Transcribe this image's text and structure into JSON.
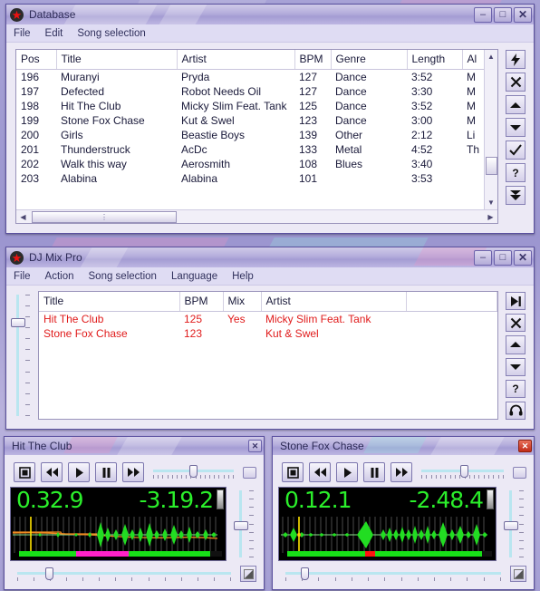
{
  "desktop": {
    "bg_color": "#a29ccf"
  },
  "database_window": {
    "title": "Database",
    "icon": "red-star-icon",
    "titlebar_buttons": [
      {
        "name": "minimize",
        "glyph": "–"
      },
      {
        "name": "maximize",
        "glyph": "□"
      },
      {
        "name": "close",
        "glyph": "✕"
      }
    ],
    "menu": [
      "File",
      "Edit",
      "Song selection"
    ],
    "columns": [
      "Pos",
      "Title",
      "Artist",
      "BPM",
      "Genre",
      "Length",
      "Al"
    ],
    "rows": [
      {
        "pos": "196",
        "title": "Muranyi",
        "artist": "Pryda",
        "bpm": "127",
        "genre": "Dance",
        "length": "3:52",
        "album": "M"
      },
      {
        "pos": "197",
        "title": "Defected",
        "artist": "Robot Needs Oil",
        "bpm": "127",
        "genre": "Dance",
        "length": "3:30",
        "album": "M"
      },
      {
        "pos": "198",
        "title": "Hit The Club",
        "artist": "Micky Slim Feat. Tank",
        "bpm": "125",
        "genre": "Dance",
        "length": "3:52",
        "album": "M"
      },
      {
        "pos": "199",
        "title": "Stone Fox Chase",
        "artist": "Kut & Swel",
        "bpm": "123",
        "genre": "Dance",
        "length": "3:00",
        "album": "M"
      },
      {
        "pos": "200",
        "title": "Girls",
        "artist": "Beastie Boys",
        "bpm": "139",
        "genre": "Other",
        "length": "2:12",
        "album": "Li"
      },
      {
        "pos": "201",
        "title": "Thunderstruck",
        "artist": "AcDc",
        "bpm": "133",
        "genre": "Metal",
        "length": "4:52",
        "album": "Th"
      },
      {
        "pos": "202",
        "title": "Walk this way",
        "artist": "Aerosmith",
        "bpm": "108",
        "genre": "Blues",
        "length": "3:40",
        "album": ""
      },
      {
        "pos": "203",
        "title": "Alabina",
        "artist": "Alabina",
        "bpm": "101",
        "genre": "",
        "length": "3:53",
        "album": ""
      }
    ],
    "toolbar": [
      {
        "name": "auto-bpm-button",
        "icon": "lightning-bolt-icon"
      },
      {
        "name": "remove-button",
        "icon": "cross-icon"
      },
      {
        "name": "move-up-button",
        "icon": "triangle-up-icon"
      },
      {
        "name": "move-down-button",
        "icon": "triangle-down-icon"
      },
      {
        "name": "confirm-button",
        "icon": "check-icon"
      },
      {
        "name": "help-button",
        "icon": "question-mark-icon"
      },
      {
        "name": "add-to-mix-button",
        "icon": "double-chevron-down-icon"
      }
    ]
  },
  "djmix_window": {
    "title": "DJ Mix Pro",
    "icon": "red-star-icon",
    "titlebar_buttons": [
      {
        "name": "minimize",
        "glyph": "–"
      },
      {
        "name": "maximize",
        "glyph": "□"
      },
      {
        "name": "close",
        "glyph": "✕"
      }
    ],
    "menu": [
      "File",
      "Action",
      "Song selection",
      "Language",
      "Help"
    ],
    "columns": [
      "Title",
      "BPM",
      "Mix",
      "Artist",
      ""
    ],
    "rows": [
      {
        "title": "Hit The Club",
        "bpm": "125",
        "mix": "Yes",
        "artist": "Micky Slim Feat. Tank"
      },
      {
        "title": "Stone Fox Chase",
        "bpm": "123",
        "mix": "",
        "artist": "Kut & Swel"
      }
    ],
    "toolbar": [
      {
        "name": "play-next-button",
        "icon": "skip-to-end-icon"
      },
      {
        "name": "remove-button",
        "icon": "cross-icon"
      },
      {
        "name": "move-up-button",
        "icon": "triangle-up-icon"
      },
      {
        "name": "move-down-button",
        "icon": "triangle-down-icon"
      },
      {
        "name": "help-button",
        "icon": "question-mark-icon"
      },
      {
        "name": "monitor-button",
        "icon": "headphones-icon"
      }
    ],
    "volume_slider": {
      "name": "master-volume-slider",
      "value_pct": 22
    }
  },
  "player_left": {
    "title": "Hit The Club",
    "close_glyph": "✕",
    "close_active": false,
    "transport": [
      {
        "name": "stop-button",
        "icon": "stop-icon"
      },
      {
        "name": "rewind-button",
        "icon": "rewind-icon"
      },
      {
        "name": "play-button",
        "icon": "play-icon"
      },
      {
        "name": "pause-button",
        "icon": "pause-icon"
      },
      {
        "name": "fast-forward-button",
        "icon": "fast-forward-icon"
      }
    ],
    "pitch_slider_pct": 48,
    "position_slider_pct": 14,
    "gain_slider_pct": 52,
    "time_elapsed": "0.32.9",
    "time_remaining": "-3.19.2",
    "progress_segments": [
      {
        "color": "#18e018",
        "start_pct": 0,
        "width_pct": 28
      },
      {
        "color": "#ff22c8",
        "start_pct": 28,
        "width_pct": 26
      },
      {
        "color": "#18e018",
        "start_pct": 54,
        "width_pct": 40
      }
    ]
  },
  "player_right": {
    "title": "Stone Fox Chase",
    "close_glyph": "✕",
    "close_active": true,
    "transport": [
      {
        "name": "stop-button",
        "icon": "stop-icon"
      },
      {
        "name": "rewind-button",
        "icon": "rewind-icon"
      },
      {
        "name": "play-button",
        "icon": "play-icon"
      },
      {
        "name": "pause-button",
        "icon": "pause-icon"
      },
      {
        "name": "fast-forward-button",
        "icon": "fast-forward-icon"
      }
    ],
    "pitch_slider_pct": 50,
    "position_slider_pct": 8,
    "gain_slider_pct": 52,
    "time_elapsed": "0.12.1",
    "time_remaining": "-2.48.4",
    "progress_segments": [
      {
        "color": "#18e018",
        "start_pct": 0,
        "width_pct": 38
      },
      {
        "color": "#ff1111",
        "start_pct": 38,
        "width_pct": 5
      },
      {
        "color": "#18e018",
        "start_pct": 43,
        "width_pct": 52
      }
    ]
  }
}
